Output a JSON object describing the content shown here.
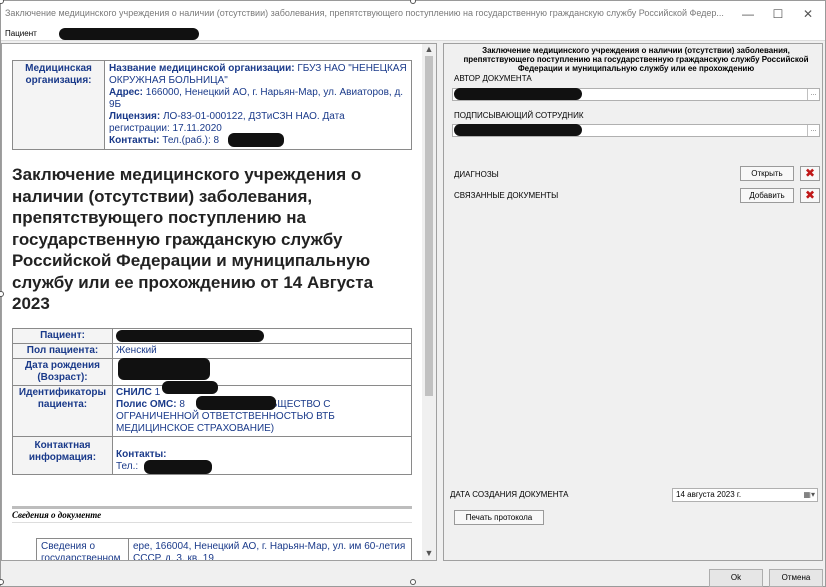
{
  "window": {
    "title": "Заключение медицинского учреждения о наличии (отсутствии) заболевания, препятствующего поступлению на государственную гражданскую службу Российской Федер...",
    "minimize": "—",
    "maximize": "☐",
    "close": "✕"
  },
  "patient_bar": {
    "label": "Пациент"
  },
  "org_table": {
    "header": "Медицинская организация:",
    "name_label": "Название медицинской организации:",
    "name_value": "ГБУЗ НАО \"НЕНЕЦКАЯ ОКРУЖНАЯ БОЛЬНИЦА\"",
    "address_label": "Адрес:",
    "address_value": "166000, Ненецкий АО, г. Нарьян-Мар, ул. Авиаторов, д. 9Б",
    "license_label": "Лицензия:",
    "license_value": "ЛО-83-01-000122, ДЗТиСЗН НАО. Дата регистрации: 17.11.2020",
    "contacts_label": "Контакты:",
    "contacts_value": "Тел.(раб.): 8"
  },
  "doc_title": "Заключение медицинского учреждения о наличии (отсутствии) заболевания, препятствующего поступлению на государственную гражданскую службу Российской Федерации и муниципальную службу или ее прохождению от 14 Августа 2023",
  "patient_table": {
    "patient_label": "Пациент:",
    "sex_label": "Пол пациента:",
    "sex_value": "Женский",
    "dob_label": "Дата рождения (Возраст):",
    "ids_label": "Идентификаторы пациента:",
    "snils_label": "СНИЛС",
    "snils_value": "1",
    "oms_label": "Полис ОМС:",
    "oms_value": "8",
    "oms_org": "(ОБЩЕСТВО С ОГРАНИЧЕННОЙ ОТВЕТСТВЕННОСТЬЮ ВТБ МЕДИЦИНСКОЕ СТРАХОВАНИЕ)",
    "contact_label": "Контактная информация:",
    "contacts_label": "Контакты:",
    "phone_label": "Тел.:"
  },
  "section": {
    "title": "Сведения о документе"
  },
  "info_table": {
    "label": "Сведения о государственном",
    "value": "ере, 166004, Ненецкий АО, г. Нарьян-Мар, ул. им 60-летия СССР, д. 3, кв. 19"
  },
  "right_panel": {
    "title": "Заключение медицинского учреждения о наличии (отсутствии) заболевания, препятствующего поступлению на государственную гражданскую службу Российской Федерации и муниципальную службу или ее прохождению",
    "author_label": "АВТОР ДОКУМЕНТА",
    "signer_label": "ПОДПИСЫВАЮЩИЙ СОТРУДНИК",
    "diagnoses_label": "ДИАГНОЗЫ",
    "open_button": "Открыть",
    "related_label": "СВЯЗАННЫЕ ДОКУМЕНТЫ",
    "add_button": "Добавить",
    "delete_glyph": "✖",
    "ellipsis": "...",
    "created_label": "ДАТА СОЗДАНИЯ ДОКУМЕНТА",
    "created_value": "14  августа  2023 г.",
    "print_button": "Печать протокола"
  },
  "footer": {
    "ok": "Ok",
    "cancel": "Отмена"
  }
}
